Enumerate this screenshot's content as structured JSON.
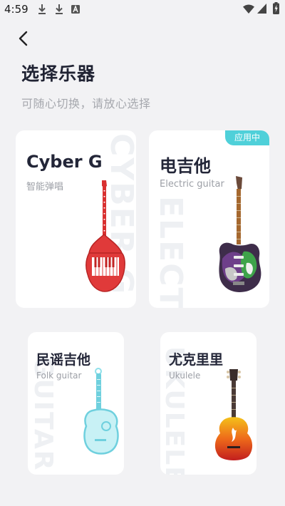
{
  "status_bar": {
    "time": "4:59",
    "icons": [
      "download-icon",
      "download-icon",
      "accessibility-icon",
      "wifi-icon",
      "signal-icon",
      "battery-charging-icon"
    ]
  },
  "header": {
    "title": "选择乐器",
    "subtitle": "可随心切换，请放心选择"
  },
  "instruments": [
    {
      "title": "Cyber G",
      "subtitle": "智能弹唱",
      "watermark": "CYBER G",
      "icon": "cyber-guitar-image",
      "badge": "",
      "accent": "#e23434"
    },
    {
      "title": "电吉他",
      "subtitle": "Electric guitar",
      "watermark": "ELECTRIC",
      "icon": "electric-guitar-image",
      "badge": "应用中",
      "accent": "#4fd0d9"
    },
    {
      "title": "民谣吉他",
      "subtitle": "Folk guitar",
      "watermark": "GUITAR",
      "icon": "folk-guitar-image",
      "badge": "",
      "accent": "#8fe0ea"
    },
    {
      "title": "尤克里里",
      "subtitle": "Ukulele",
      "watermark": "UKULELE",
      "icon": "ukulele-image",
      "badge": "",
      "accent": "#e8581c"
    }
  ]
}
